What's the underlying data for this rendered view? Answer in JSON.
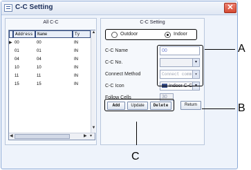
{
  "window": {
    "title": "C-C Setting"
  },
  "left_panel": {
    "title": "All C-C",
    "columns": [
      "Address",
      "Name",
      "Ty"
    ],
    "rows": [
      {
        "marker": "▶",
        "address": "00",
        "name": "00",
        "type": "IN"
      },
      {
        "marker": "",
        "address": "01",
        "name": "01",
        "type": "IN"
      },
      {
        "marker": "",
        "address": "04",
        "name": "04",
        "type": "IN"
      },
      {
        "marker": "",
        "address": "10",
        "name": "10",
        "type": "IN"
      },
      {
        "marker": "",
        "address": "11",
        "name": "11",
        "type": "IN"
      },
      {
        "marker": "",
        "address": "15",
        "name": "15",
        "type": "IN"
      }
    ]
  },
  "right_panel": {
    "title": "C-C Setting",
    "radio": {
      "outdoor": "Outdoor",
      "indoor": "Indoor",
      "selected": "indoor"
    },
    "fields": {
      "name_label": "C-C Name",
      "name_value": "00",
      "no_label": "C-C No.",
      "no_value": "",
      "method_label": "Connect Method",
      "method_value": "Connect comm",
      "icon_label": "C-C Icon",
      "icon_value": "Indoor C-C",
      "follow_label": "Follow Cells",
      "follow_value": "30"
    },
    "buttons": {
      "add": "Add",
      "update": "Update",
      "delete": "Delete",
      "return": "Return"
    }
  },
  "callouts": {
    "a": "A",
    "b": "B",
    "c": "C"
  }
}
